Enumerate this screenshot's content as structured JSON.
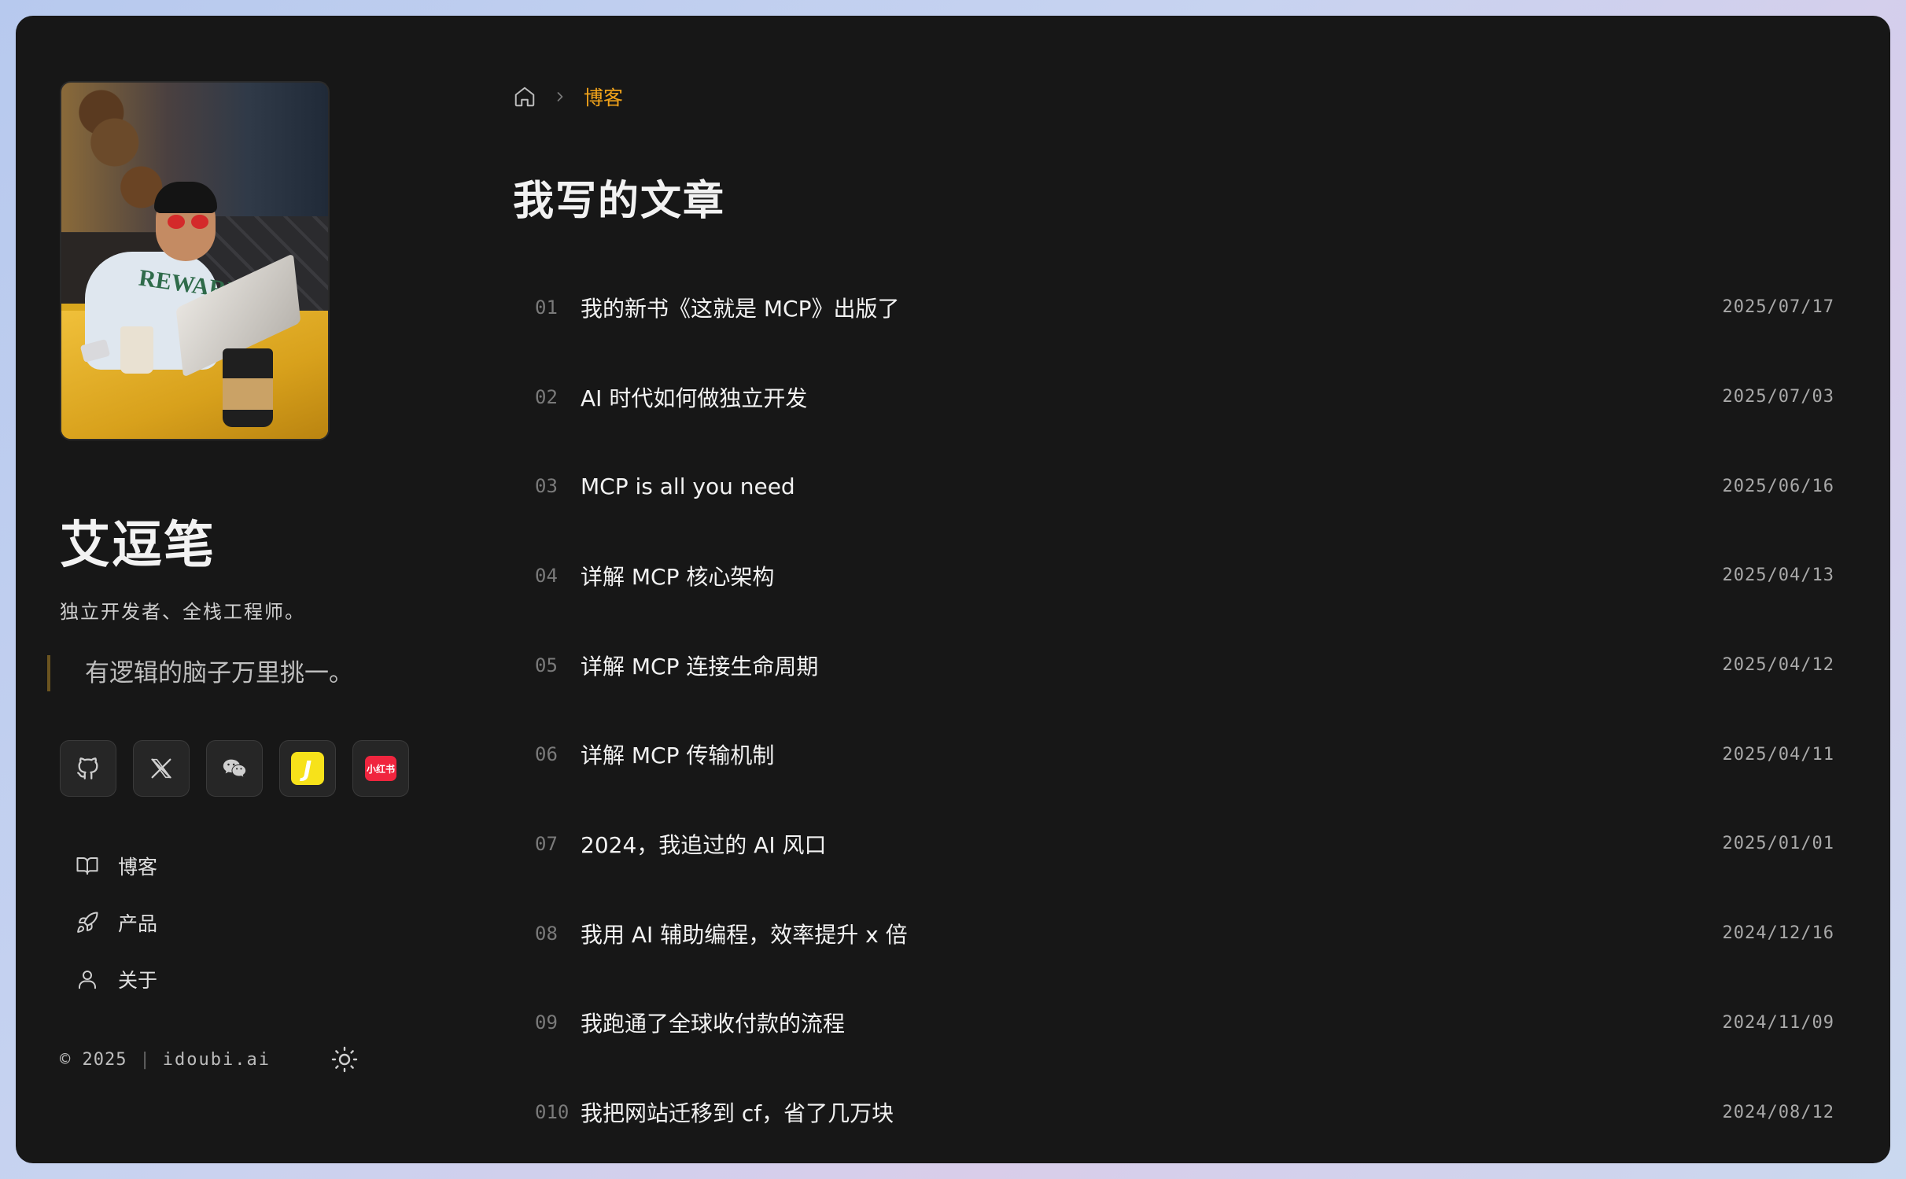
{
  "profile": {
    "name": "艾逗笔",
    "bio": "独立开发者、全栈工程师。",
    "quote": "有逻辑的脑子万里挑一。",
    "photo_shirt_text": "REWARI"
  },
  "socials": [
    {
      "name": "github-icon"
    },
    {
      "name": "x-icon"
    },
    {
      "name": "wechat-icon"
    },
    {
      "name": "jike-icon",
      "glyph": "J"
    },
    {
      "name": "xiaohongshu-icon",
      "glyph": "小红书"
    }
  ],
  "nav": [
    {
      "label": "博客",
      "icon": "book-icon"
    },
    {
      "label": "产品",
      "icon": "rocket-icon"
    },
    {
      "label": "关于",
      "icon": "user-icon"
    }
  ],
  "footer": {
    "copyright": "© 2025",
    "separator": "|",
    "domain": "idoubi.ai"
  },
  "breadcrumb": {
    "current": "博客"
  },
  "page_title": "我写的文章",
  "articles": [
    {
      "num": "01",
      "title": "我的新书《这就是 MCP》出版了",
      "date": "2025/07/17"
    },
    {
      "num": "02",
      "title": "AI 时代如何做独立开发",
      "date": "2025/07/03"
    },
    {
      "num": "03",
      "title": "MCP is all you need",
      "date": "2025/06/16"
    },
    {
      "num": "04",
      "title": "详解 MCP 核心架构",
      "date": "2025/04/13"
    },
    {
      "num": "05",
      "title": "详解 MCP 连接生命周期",
      "date": "2025/04/12"
    },
    {
      "num": "06",
      "title": "详解 MCP 传输机制",
      "date": "2025/04/11"
    },
    {
      "num": "07",
      "title": "2024，我追过的 AI 风口",
      "date": "2025/01/01"
    },
    {
      "num": "08",
      "title": "我用 AI 辅助编程，效率提升 x 倍",
      "date": "2024/12/16"
    },
    {
      "num": "09",
      "title": "我跑通了全球收付款的流程",
      "date": "2024/11/09"
    },
    {
      "num": "010",
      "title": "我把网站迁移到 cf，省了几万块",
      "date": "2024/08/12"
    }
  ],
  "colors": {
    "background": "#171717",
    "accent": "#f0a21a",
    "text": "#f2f2f2",
    "muted": "#7a7a7a"
  }
}
